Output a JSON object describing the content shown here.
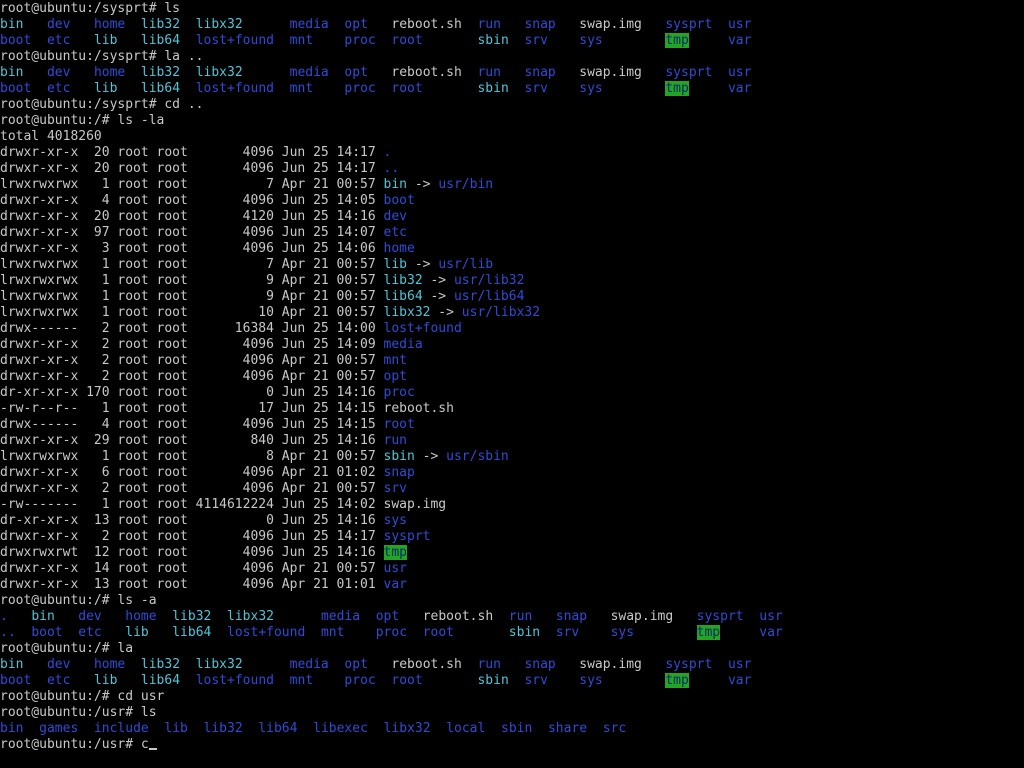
{
  "terminal": {
    "colors": {
      "background": "#000000",
      "text": "#c8c8c8",
      "directory": "#2f4bd6",
      "symlink": "#4fc6d8",
      "executable": "#22b022",
      "sticky_dir_bg": "#23a523"
    },
    "lines": [
      [
        {
          "t": "root@ubuntu:/sysprt# ls",
          "c": "w"
        }
      ],
      [
        {
          "t": "bin   ",
          "c": "c"
        },
        {
          "t": "dev   ",
          "c": "b"
        },
        {
          "t": "home  ",
          "c": "b"
        },
        {
          "t": "lib32  ",
          "c": "c"
        },
        {
          "t": "libx32      ",
          "c": "c"
        },
        {
          "t": "media  ",
          "c": "b"
        },
        {
          "t": "opt   ",
          "c": "b"
        },
        {
          "t": "reboot.sh  ",
          "c": "w"
        },
        {
          "t": "run   ",
          "c": "b"
        },
        {
          "t": "snap   ",
          "c": "b"
        },
        {
          "t": "swap.img   ",
          "c": "w"
        },
        {
          "t": "sysprt  ",
          "c": "b"
        },
        {
          "t": "usr",
          "c": "b"
        }
      ],
      [
        {
          "t": "boot  ",
          "c": "b"
        },
        {
          "t": "etc   ",
          "c": "b"
        },
        {
          "t": "lib   ",
          "c": "c"
        },
        {
          "t": "lib64  ",
          "c": "c"
        },
        {
          "t": "lost+found  ",
          "c": "b"
        },
        {
          "t": "mnt    ",
          "c": "b"
        },
        {
          "t": "proc  ",
          "c": "b"
        },
        {
          "t": "root       ",
          "c": "b"
        },
        {
          "t": "sbin  ",
          "c": "c"
        },
        {
          "t": "srv    ",
          "c": "b"
        },
        {
          "t": "sys        ",
          "c": "b"
        },
        {
          "t": "tmp",
          "c": "tmp"
        },
        {
          "t": "     ",
          "c": "w"
        },
        {
          "t": "var",
          "c": "b"
        }
      ],
      [
        {
          "t": "root@ubuntu:/sysprt# la ..",
          "c": "w"
        }
      ],
      [
        {
          "t": "bin   ",
          "c": "c"
        },
        {
          "t": "dev   ",
          "c": "b"
        },
        {
          "t": "home  ",
          "c": "b"
        },
        {
          "t": "lib32  ",
          "c": "c"
        },
        {
          "t": "libx32      ",
          "c": "c"
        },
        {
          "t": "media  ",
          "c": "b"
        },
        {
          "t": "opt   ",
          "c": "b"
        },
        {
          "t": "reboot.sh  ",
          "c": "w"
        },
        {
          "t": "run   ",
          "c": "b"
        },
        {
          "t": "snap   ",
          "c": "b"
        },
        {
          "t": "swap.img   ",
          "c": "w"
        },
        {
          "t": "sysprt  ",
          "c": "b"
        },
        {
          "t": "usr",
          "c": "b"
        }
      ],
      [
        {
          "t": "boot  ",
          "c": "b"
        },
        {
          "t": "etc   ",
          "c": "b"
        },
        {
          "t": "lib   ",
          "c": "c"
        },
        {
          "t": "lib64  ",
          "c": "c"
        },
        {
          "t": "lost+found  ",
          "c": "b"
        },
        {
          "t": "mnt    ",
          "c": "b"
        },
        {
          "t": "proc  ",
          "c": "b"
        },
        {
          "t": "root       ",
          "c": "b"
        },
        {
          "t": "sbin  ",
          "c": "c"
        },
        {
          "t": "srv    ",
          "c": "b"
        },
        {
          "t": "sys        ",
          "c": "b"
        },
        {
          "t": "tmp",
          "c": "tmp"
        },
        {
          "t": "     ",
          "c": "w"
        },
        {
          "t": "var",
          "c": "b"
        }
      ],
      [
        {
          "t": "root@ubuntu:/sysprt# cd ..",
          "c": "w"
        }
      ],
      [
        {
          "t": "root@ubuntu:/# ls -la",
          "c": "w"
        }
      ],
      [
        {
          "t": "total 4018260",
          "c": "w"
        }
      ],
      [
        {
          "t": "drwxr-xr-x  20 root root       4096 Jun 25 14:17 ",
          "c": "w"
        },
        {
          "t": ".",
          "c": "b"
        }
      ],
      [
        {
          "t": "drwxr-xr-x  20 root root       4096 Jun 25 14:17 ",
          "c": "w"
        },
        {
          "t": "..",
          "c": "b"
        }
      ],
      [
        {
          "t": "lrwxrwxrwx   1 root root          7 Apr 21 00:57 ",
          "c": "w"
        },
        {
          "t": "bin",
          "c": "c"
        },
        {
          "t": " -> ",
          "c": "w"
        },
        {
          "t": "usr/bin",
          "c": "b"
        }
      ],
      [
        {
          "t": "drwxr-xr-x   4 root root       4096 Jun 25 14:05 ",
          "c": "w"
        },
        {
          "t": "boot",
          "c": "b"
        }
      ],
      [
        {
          "t": "drwxr-xr-x  20 root root       4120 Jun 25 14:16 ",
          "c": "w"
        },
        {
          "t": "dev",
          "c": "b"
        }
      ],
      [
        {
          "t": "drwxr-xr-x  97 root root       4096 Jun 25 14:07 ",
          "c": "w"
        },
        {
          "t": "etc",
          "c": "b"
        }
      ],
      [
        {
          "t": "drwxr-xr-x   3 root root       4096 Jun 25 14:06 ",
          "c": "w"
        },
        {
          "t": "home",
          "c": "b"
        }
      ],
      [
        {
          "t": "lrwxrwxrwx   1 root root          7 Apr 21 00:57 ",
          "c": "w"
        },
        {
          "t": "lib",
          "c": "c"
        },
        {
          "t": " -> ",
          "c": "w"
        },
        {
          "t": "usr/lib",
          "c": "b"
        }
      ],
      [
        {
          "t": "lrwxrwxrwx   1 root root          9 Apr 21 00:57 ",
          "c": "w"
        },
        {
          "t": "lib32",
          "c": "c"
        },
        {
          "t": " -> ",
          "c": "w"
        },
        {
          "t": "usr/lib32",
          "c": "b"
        }
      ],
      [
        {
          "t": "lrwxrwxrwx   1 root root          9 Apr 21 00:57 ",
          "c": "w"
        },
        {
          "t": "lib64",
          "c": "c"
        },
        {
          "t": " -> ",
          "c": "w"
        },
        {
          "t": "usr/lib64",
          "c": "b"
        }
      ],
      [
        {
          "t": "lrwxrwxrwx   1 root root         10 Apr 21 00:57 ",
          "c": "w"
        },
        {
          "t": "libx32",
          "c": "c"
        },
        {
          "t": " -> ",
          "c": "w"
        },
        {
          "t": "usr/libx32",
          "c": "b"
        }
      ],
      [
        {
          "t": "drwx------   2 root root      16384 Jun 25 14:00 ",
          "c": "w"
        },
        {
          "t": "lost+found",
          "c": "b"
        }
      ],
      [
        {
          "t": "drwxr-xr-x   2 root root       4096 Jun 25 14:09 ",
          "c": "w"
        },
        {
          "t": "media",
          "c": "b"
        }
      ],
      [
        {
          "t": "drwxr-xr-x   2 root root       4096 Apr 21 00:57 ",
          "c": "w"
        },
        {
          "t": "mnt",
          "c": "b"
        }
      ],
      [
        {
          "t": "drwxr-xr-x   2 root root       4096 Apr 21 00:57 ",
          "c": "w"
        },
        {
          "t": "opt",
          "c": "b"
        }
      ],
      [
        {
          "t": "dr-xr-xr-x 170 root root          0 Jun 25 14:16 ",
          "c": "w"
        },
        {
          "t": "proc",
          "c": "b"
        }
      ],
      [
        {
          "t": "-rw-r--r--   1 root root         17 Jun 25 14:15 ",
          "c": "w"
        },
        {
          "t": "reboot.sh",
          "c": "w"
        }
      ],
      [
        {
          "t": "drwx------   4 root root       4096 Jun 25 14:15 ",
          "c": "w"
        },
        {
          "t": "root",
          "c": "b"
        }
      ],
      [
        {
          "t": "drwxr-xr-x  29 root root        840 Jun 25 14:16 ",
          "c": "w"
        },
        {
          "t": "run",
          "c": "b"
        }
      ],
      [
        {
          "t": "lrwxrwxrwx   1 root root          8 Apr 21 00:57 ",
          "c": "w"
        },
        {
          "t": "sbin",
          "c": "c"
        },
        {
          "t": " -> ",
          "c": "w"
        },
        {
          "t": "usr/sbin",
          "c": "b"
        }
      ],
      [
        {
          "t": "drwxr-xr-x   6 root root       4096 Apr 21 01:02 ",
          "c": "w"
        },
        {
          "t": "snap",
          "c": "b"
        }
      ],
      [
        {
          "t": "drwxr-xr-x   2 root root       4096 Apr 21 00:57 ",
          "c": "w"
        },
        {
          "t": "srv",
          "c": "b"
        }
      ],
      [
        {
          "t": "-rw-------   1 root root 4114612224 Jun 25 14:02 ",
          "c": "w"
        },
        {
          "t": "swap.img",
          "c": "w"
        }
      ],
      [
        {
          "t": "dr-xr-xr-x  13 root root          0 Jun 25 14:16 ",
          "c": "w"
        },
        {
          "t": "sys",
          "c": "b"
        }
      ],
      [
        {
          "t": "drwxr-xr-x   2 root root       4096 Jun 25 14:17 ",
          "c": "w"
        },
        {
          "t": "sysprt",
          "c": "b"
        }
      ],
      [
        {
          "t": "drwxrwxrwt  12 root root       4096 Jun 25 14:16 ",
          "c": "w"
        },
        {
          "t": "tmp",
          "c": "tmp"
        }
      ],
      [
        {
          "t": "drwxr-xr-x  14 root root       4096 Apr 21 00:57 ",
          "c": "w"
        },
        {
          "t": "usr",
          "c": "b"
        }
      ],
      [
        {
          "t": "drwxr-xr-x  13 root root       4096 Apr 21 01:01 ",
          "c": "w"
        },
        {
          "t": "var",
          "c": "b"
        }
      ],
      [
        {
          "t": "root@ubuntu:/# ls -a",
          "c": "w"
        }
      ],
      [
        {
          "t": ".   ",
          "c": "b"
        },
        {
          "t": "bin   ",
          "c": "c"
        },
        {
          "t": "dev   ",
          "c": "b"
        },
        {
          "t": "home  ",
          "c": "b"
        },
        {
          "t": "lib32  ",
          "c": "c"
        },
        {
          "t": "libx32      ",
          "c": "c"
        },
        {
          "t": "media  ",
          "c": "b"
        },
        {
          "t": "opt   ",
          "c": "b"
        },
        {
          "t": "reboot.sh  ",
          "c": "w"
        },
        {
          "t": "run   ",
          "c": "b"
        },
        {
          "t": "snap   ",
          "c": "b"
        },
        {
          "t": "swap.img   ",
          "c": "w"
        },
        {
          "t": "sysprt  ",
          "c": "b"
        },
        {
          "t": "usr",
          "c": "b"
        }
      ],
      [
        {
          "t": "..  ",
          "c": "b"
        },
        {
          "t": "boot  ",
          "c": "b"
        },
        {
          "t": "etc   ",
          "c": "b"
        },
        {
          "t": "lib   ",
          "c": "c"
        },
        {
          "t": "lib64  ",
          "c": "c"
        },
        {
          "t": "lost+found  ",
          "c": "b"
        },
        {
          "t": "mnt    ",
          "c": "b"
        },
        {
          "t": "proc  ",
          "c": "b"
        },
        {
          "t": "root       ",
          "c": "b"
        },
        {
          "t": "sbin  ",
          "c": "c"
        },
        {
          "t": "srv    ",
          "c": "b"
        },
        {
          "t": "sys        ",
          "c": "b"
        },
        {
          "t": "tmp",
          "c": "tmp"
        },
        {
          "t": "     ",
          "c": "w"
        },
        {
          "t": "var",
          "c": "b"
        }
      ],
      [
        {
          "t": "root@ubuntu:/# la",
          "c": "w"
        }
      ],
      [
        {
          "t": "bin   ",
          "c": "c"
        },
        {
          "t": "dev   ",
          "c": "b"
        },
        {
          "t": "home  ",
          "c": "b"
        },
        {
          "t": "lib32  ",
          "c": "c"
        },
        {
          "t": "libx32      ",
          "c": "c"
        },
        {
          "t": "media  ",
          "c": "b"
        },
        {
          "t": "opt   ",
          "c": "b"
        },
        {
          "t": "reboot.sh  ",
          "c": "w"
        },
        {
          "t": "run   ",
          "c": "b"
        },
        {
          "t": "snap   ",
          "c": "b"
        },
        {
          "t": "swap.img   ",
          "c": "w"
        },
        {
          "t": "sysprt  ",
          "c": "b"
        },
        {
          "t": "usr",
          "c": "b"
        }
      ],
      [
        {
          "t": "boot  ",
          "c": "b"
        },
        {
          "t": "etc   ",
          "c": "b"
        },
        {
          "t": "lib   ",
          "c": "c"
        },
        {
          "t": "lib64  ",
          "c": "c"
        },
        {
          "t": "lost+found  ",
          "c": "b"
        },
        {
          "t": "mnt    ",
          "c": "b"
        },
        {
          "t": "proc  ",
          "c": "b"
        },
        {
          "t": "root       ",
          "c": "b"
        },
        {
          "t": "sbin  ",
          "c": "c"
        },
        {
          "t": "srv    ",
          "c": "b"
        },
        {
          "t": "sys        ",
          "c": "b"
        },
        {
          "t": "tmp",
          "c": "tmp"
        },
        {
          "t": "     ",
          "c": "w"
        },
        {
          "t": "var",
          "c": "b"
        }
      ],
      [
        {
          "t": "root@ubuntu:/# cd usr",
          "c": "w"
        }
      ],
      [
        {
          "t": "root@ubuntu:/usr# ls",
          "c": "w"
        }
      ],
      [
        {
          "t": "bin  ",
          "c": "b"
        },
        {
          "t": "games  ",
          "c": "b"
        },
        {
          "t": "include  ",
          "c": "b"
        },
        {
          "t": "lib  ",
          "c": "b"
        },
        {
          "t": "lib32  ",
          "c": "b"
        },
        {
          "t": "lib64  ",
          "c": "b"
        },
        {
          "t": "libexec  ",
          "c": "b"
        },
        {
          "t": "libx32  ",
          "c": "b"
        },
        {
          "t": "local  ",
          "c": "b"
        },
        {
          "t": "sbin  ",
          "c": "b"
        },
        {
          "t": "share  ",
          "c": "b"
        },
        {
          "t": "src",
          "c": "b"
        }
      ]
    ],
    "prompt": {
      "text": "root@ubuntu:/usr# c"
    }
  }
}
